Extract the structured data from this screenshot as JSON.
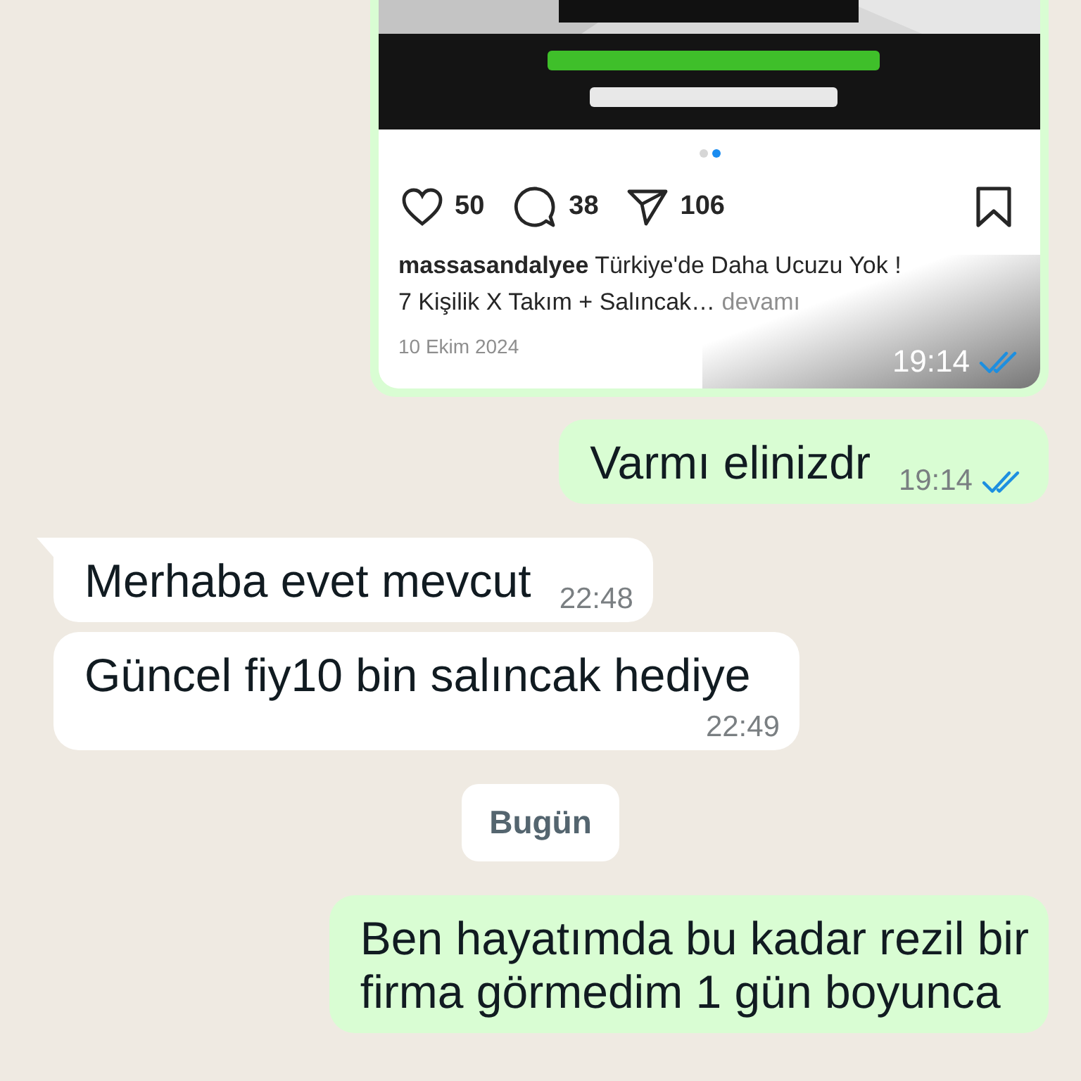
{
  "messages": [
    {
      "kind": "post",
      "outgoing": true,
      "slides": [
        {
          "selected": false
        },
        {
          "selected": true
        }
      ],
      "likes": "50",
      "comments": "38",
      "shares": "106",
      "username": "massasandalyee",
      "caption_lines": [
        "Türkiye'de Daha Ucuzu Yok !",
        "7 Kişilik X Takım + Salıncak…"
      ],
      "more": "devamı",
      "date": "10 Ekim 2024",
      "time": "19:14",
      "read": true
    },
    {
      "kind": "text",
      "outgoing": true,
      "text": "Varmı elinizdr",
      "time": "19:14",
      "read": true
    },
    {
      "kind": "text",
      "outgoing": false,
      "tail": true,
      "text": "Merhaba evet mevcut",
      "time": "22:48"
    },
    {
      "kind": "text",
      "outgoing": false,
      "tail": false,
      "text": "Güncel fiy10 bin salıncak hediye",
      "time": "22:49"
    },
    {
      "kind": "date",
      "text": "Bugün"
    },
    {
      "kind": "text",
      "outgoing": true,
      "text": "Ben hayatımda bu kadar rezil bir\nfirma görmedim 1 gün boyunca"
    }
  ]
}
